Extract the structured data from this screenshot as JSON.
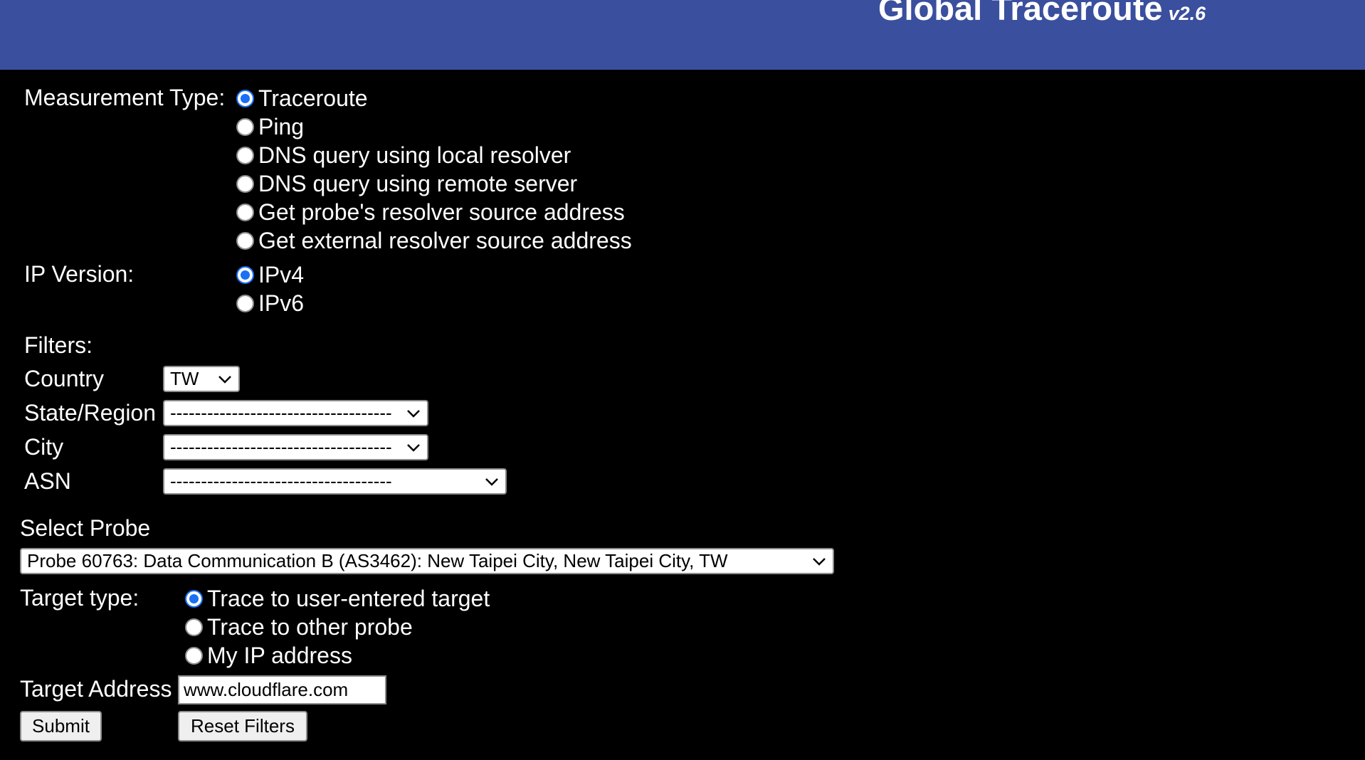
{
  "header": {
    "title": "Global Traceroute",
    "version": "v2.6",
    "background_color": "#3a4f9d"
  },
  "measurement": {
    "label": "Measurement Type:",
    "options": [
      {
        "label": "Traceroute",
        "checked": true
      },
      {
        "label": "Ping",
        "checked": false
      },
      {
        "label": "DNS query using local resolver",
        "checked": false
      },
      {
        "label": "DNS query using remote server",
        "checked": false
      },
      {
        "label": "Get probe's resolver source address",
        "checked": false
      },
      {
        "label": "Get external resolver source address",
        "checked": false
      }
    ]
  },
  "ip_version": {
    "label": "IP Version:",
    "options": [
      {
        "label": "IPv4",
        "checked": true
      },
      {
        "label": "IPv6",
        "checked": false
      }
    ]
  },
  "filters": {
    "label": "Filters:",
    "country": {
      "label": "Country",
      "value": "TW"
    },
    "state": {
      "label": "State/Region",
      "value": "------------------------------------"
    },
    "city": {
      "label": "City",
      "value": "------------------------------------"
    },
    "asn": {
      "label": "ASN",
      "value": "------------------------------------"
    }
  },
  "probe": {
    "label": "Select Probe",
    "value": "Probe 60763: Data Communication B (AS3462): New Taipei City, New Taipei City, TW"
  },
  "target_type": {
    "label": "Target type:",
    "options": [
      {
        "label": "Trace to user-entered target",
        "checked": true
      },
      {
        "label": "Trace to other probe",
        "checked": false
      },
      {
        "label": "My IP address",
        "checked": false
      }
    ]
  },
  "target_address": {
    "label": "Target Address",
    "value": "www.cloudflare.com"
  },
  "buttons": {
    "submit": "Submit",
    "reset": "Reset Filters"
  },
  "colors": {
    "radio_accent": "#1a6ff5",
    "page_background": "#000000"
  }
}
